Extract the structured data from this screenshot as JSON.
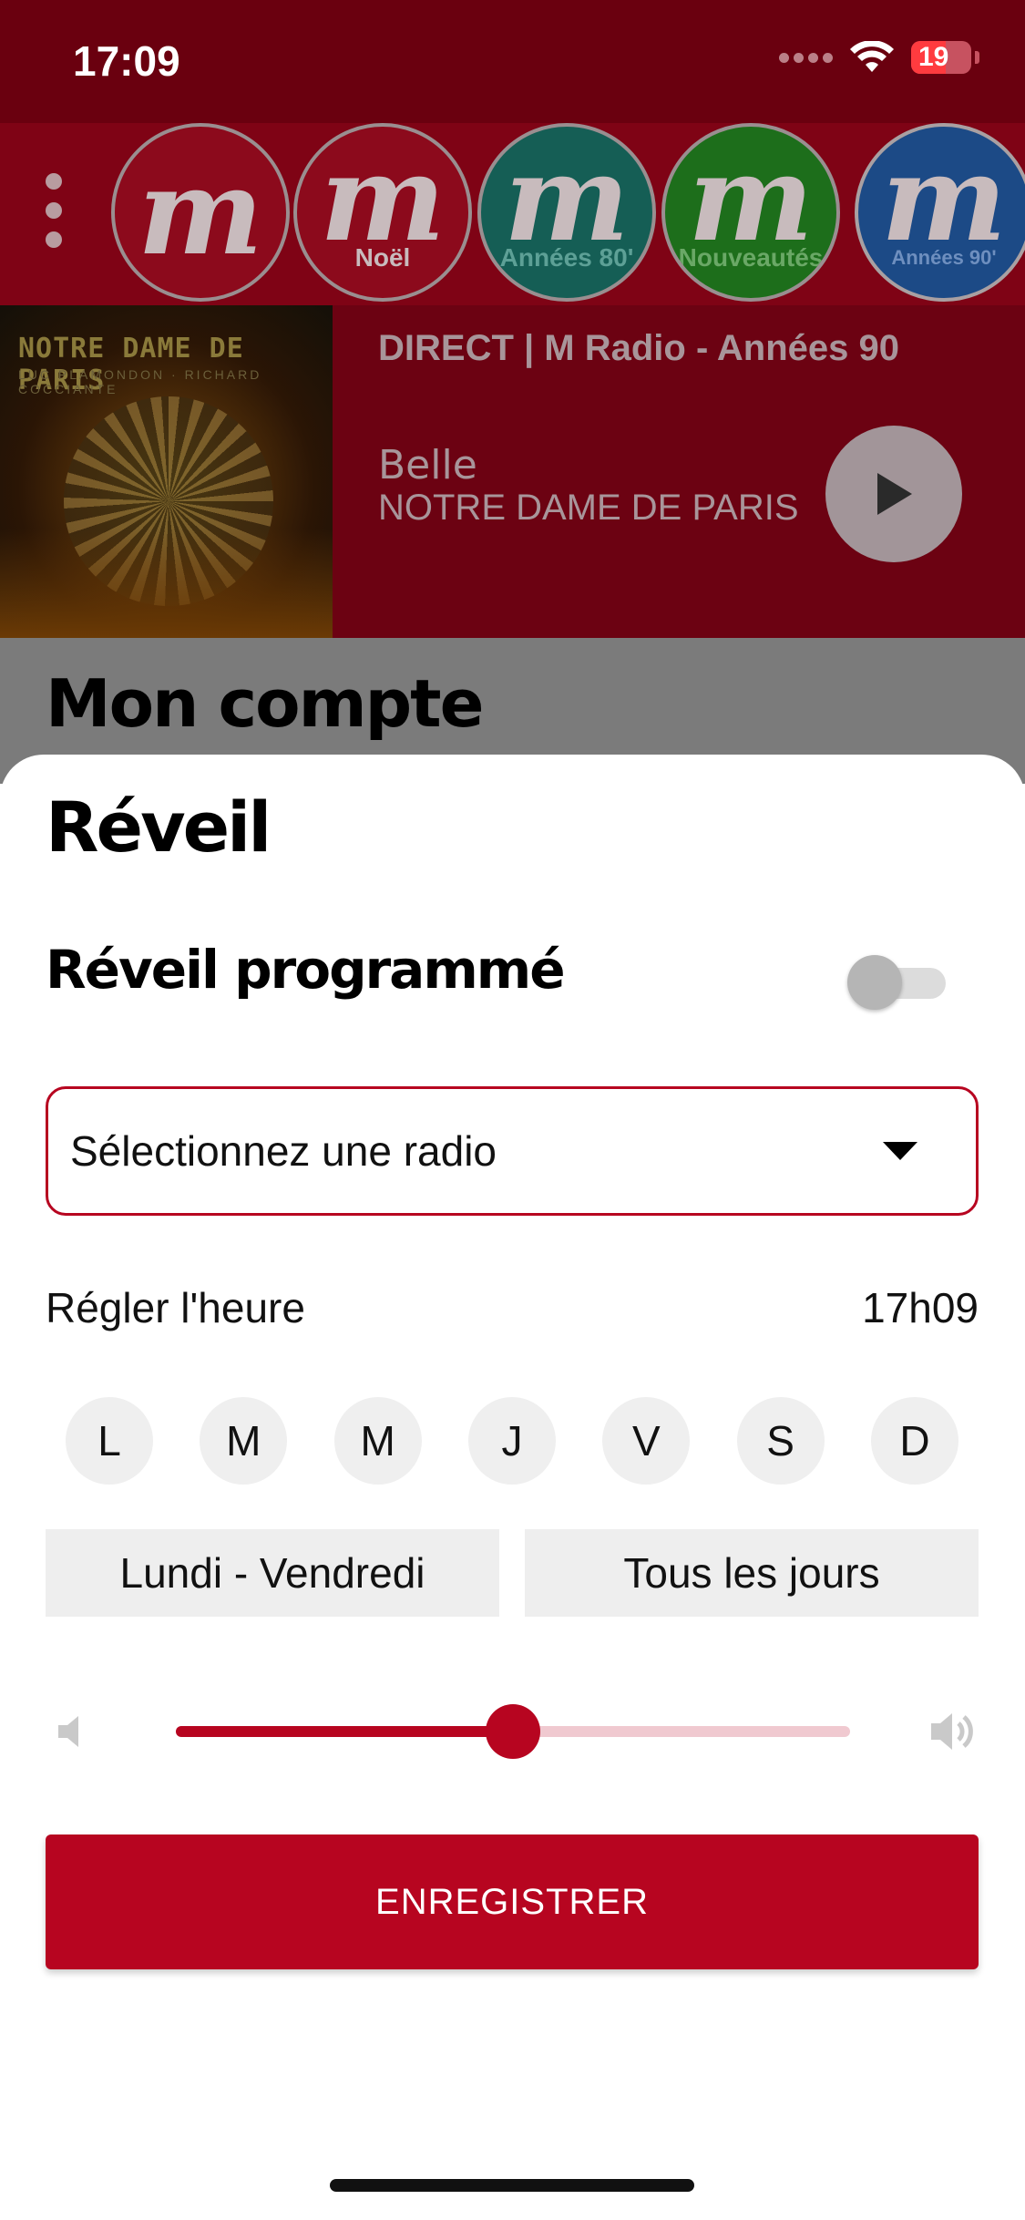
{
  "status_bar": {
    "time": "17:09",
    "battery": "19"
  },
  "stations": [
    {
      "name": "M Radio",
      "logo_letter": "m",
      "sub": ""
    },
    {
      "name": "M Radio Noël",
      "logo_letter": "m",
      "sub": "Noël"
    },
    {
      "name": "M Radio Années 80",
      "logo_letter": "m",
      "sub": "Années 80'"
    },
    {
      "name": "M Radio Nouveautés",
      "logo_letter": "m",
      "sub": "Nouveautés"
    },
    {
      "name": "M Radio Années 90",
      "logo_letter": "m",
      "sub": "Années 90'"
    }
  ],
  "now_playing": {
    "cover_title": "NOTRE DAME DE PARIS",
    "cover_sub": "LUC PLAMONDON · RICHARD COCCIANTE",
    "direct_label": "DIRECT | M Radio - Années 90",
    "song_title": "Belle",
    "song_artist": "NOTRE DAME DE PARIS"
  },
  "account": {
    "title": "Mon compte"
  },
  "sheet": {
    "title": "Réveil",
    "alarm_label": "Réveil programmé",
    "alarm_enabled": false,
    "radio_select_placeholder": "Sélectionnez une radio",
    "time_label": "Régler l'heure",
    "time_value": "17h09",
    "days": [
      "L",
      "M",
      "M",
      "J",
      "V",
      "S",
      "D"
    ],
    "presets": [
      "Lundi - Vendredi",
      "Tous les jours"
    ],
    "volume_level": 0.5,
    "save_label": "ENREGISTRER"
  },
  "colors": {
    "accent": "#b70520",
    "status_bar_bg": "#6a000f",
    "station_bar_bg": "#7f0315"
  },
  "icons": {
    "volume_low": "speaker-low-icon",
    "volume_high": "speaker-high-icon",
    "play": "play-icon",
    "dropdown": "caret-down-icon",
    "menu": "more-vertical-icon",
    "wifi": "wifi-icon",
    "battery": "battery-icon"
  }
}
